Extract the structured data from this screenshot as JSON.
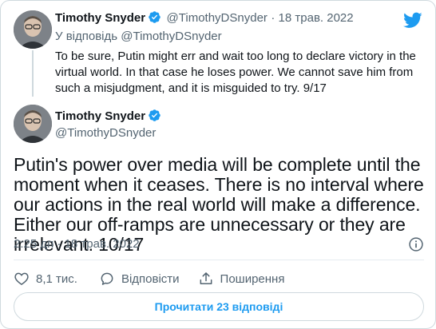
{
  "parent_tweet": {
    "author_name": "Timothy Snyder",
    "author_handle": "@TimothyDSnyder",
    "date": "· 18 трав. 2022",
    "reply_label": "У відповідь @TimothyDSnyder",
    "text": "To be sure, Putin might err and wait too long to declare victory in the virtual world. In that case he loses power. We cannot save him from such a misjudgment, and it is misguided to try. 9/17"
  },
  "main_tweet": {
    "author_name": "Timothy Snyder",
    "author_handle": "@TimothyDSnyder",
    "text": "Putin's power over media will be complete until the moment when it ceases. There is no interval where our actions in the real world will make a difference. Either our off-ramps are unnecessary or they are irrelevant. 10/17",
    "timestamp": "2:25 дп · 18 трав. 2022"
  },
  "actions": {
    "likes": "8,1 тис.",
    "reply_label": "Відповісти",
    "share_label": "Поширення"
  },
  "read_replies_label": "Прочитати 23 відповіді",
  "colors": {
    "accent": "#1d9bf0",
    "muted_text": "#536471",
    "border": "#cfd9de"
  },
  "icons": [
    "twitter-logo",
    "verified-badge",
    "info-icon",
    "heart-icon",
    "reply-icon",
    "share-icon"
  ]
}
